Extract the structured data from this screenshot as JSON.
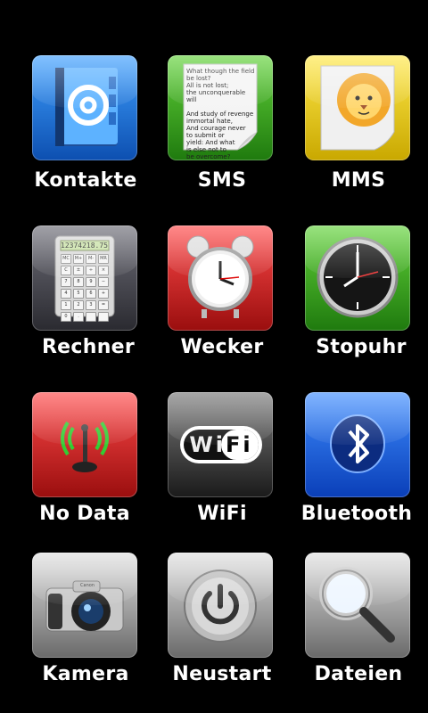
{
  "apps": [
    {
      "label": "Kontakte",
      "icon": "address-book-icon",
      "color": "#1f6fd0"
    },
    {
      "label": "SMS",
      "icon": "sms-message-icon",
      "color": "#2f9e16",
      "note_lines": [
        "What though the field",
        "be lost?",
        "All is not lost;",
        "the unconquerable will",
        "",
        "And study of revenge",
        "immortal hate,",
        "And courage never",
        "to submit or",
        "yield: And what",
        "is else not to",
        "be overcome?"
      ]
    },
    {
      "label": "MMS",
      "icon": "mms-lion-icon",
      "color": "#e0c400"
    },
    {
      "label": "Rechner",
      "icon": "calculator-icon",
      "color": "#4a4a52",
      "display": "12374218.75",
      "keys": [
        "MC",
        "M+",
        "M-",
        "MR",
        "C",
        "±",
        "÷",
        "×",
        "7",
        "8",
        "9",
        "−",
        "4",
        "5",
        "6",
        "+",
        "1",
        "2",
        "3",
        "=",
        "0",
        ".",
        "",
        ""
      ]
    },
    {
      "label": "Wecker",
      "icon": "alarm-clock-icon",
      "color": "#c41f1f"
    },
    {
      "label": "Stopuhr",
      "icon": "stopwatch-icon",
      "color": "#2f9e16"
    },
    {
      "label": "No Data",
      "icon": "no-data-antenna-icon",
      "color": "#c41f1f"
    },
    {
      "label": "WiFi",
      "icon": "wifi-icon",
      "color": "#3a3a3a",
      "logo_text": "WiFi"
    },
    {
      "label": "Bluetooth",
      "icon": "bluetooth-icon",
      "color": "#1a5fe0"
    },
    {
      "label": "Kamera",
      "icon": "camera-icon",
      "color": "#9a9a9a",
      "brand": "Canon"
    },
    {
      "label": "Neustart",
      "icon": "power-icon",
      "color": "#9a9a9a"
    },
    {
      "label": "Dateien",
      "icon": "magnifier-icon",
      "color": "#9a9a9a"
    }
  ]
}
